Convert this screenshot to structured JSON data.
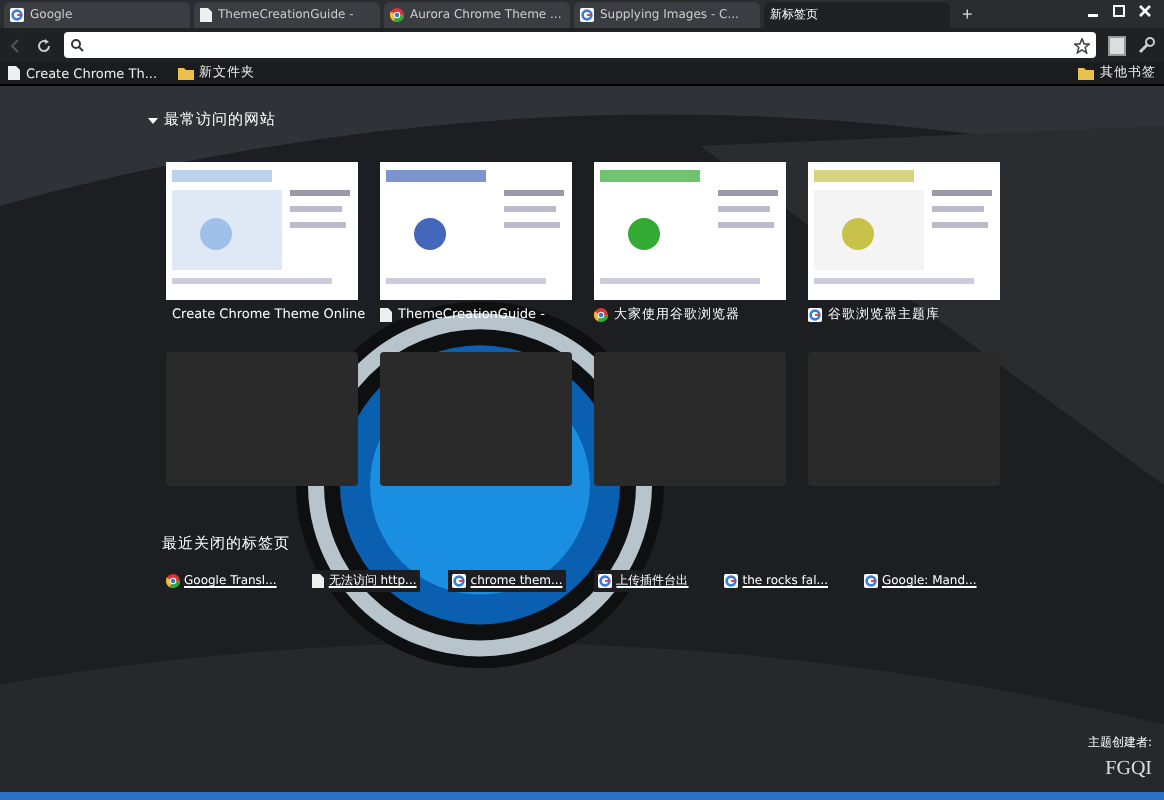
{
  "tabs": [
    {
      "label": "Google",
      "selected": false
    },
    {
      "label": "ThemeCreationGuide -",
      "selected": false
    },
    {
      "label": "Aurora Chrome Theme ...",
      "selected": false
    },
    {
      "label": "Supplying Images - C...",
      "selected": false
    },
    {
      "label": "新标签页",
      "selected": true
    }
  ],
  "new_tab_button": "+",
  "bookmarks": [
    {
      "label": "Create Chrome Th..."
    },
    {
      "label": "新文件夹"
    }
  ],
  "other_bookmarks": "其他书签",
  "most_visited": {
    "heading": "最常访问的网站",
    "expanded": true,
    "thumbnails": [
      {
        "title": "Create Chrome Theme Online",
        "kind": "site"
      },
      {
        "title": "ThemeCreationGuide - ",
        "kind": "site"
      },
      {
        "title": "大家使用谷歌浏览器",
        "kind": "site"
      },
      {
        "title": "谷歌浏览器主题库",
        "kind": "site"
      },
      {
        "kind": "empty"
      },
      {
        "kind": "empty"
      },
      {
        "kind": "empty"
      },
      {
        "kind": "empty"
      }
    ]
  },
  "recently_closed": {
    "heading": "最近关闭的标签页",
    "items": [
      {
        "label": "Google Transl..."
      },
      {
        "label": "无法访问 http..."
      },
      {
        "label": "chrome them..."
      },
      {
        "label": "上传插件台出"
      },
      {
        "label": "the rocks fal..."
      },
      {
        "label": "Google: Mand..."
      }
    ]
  },
  "theme_credit": {
    "label": "主题创建者:",
    "author": "FGQI"
  }
}
